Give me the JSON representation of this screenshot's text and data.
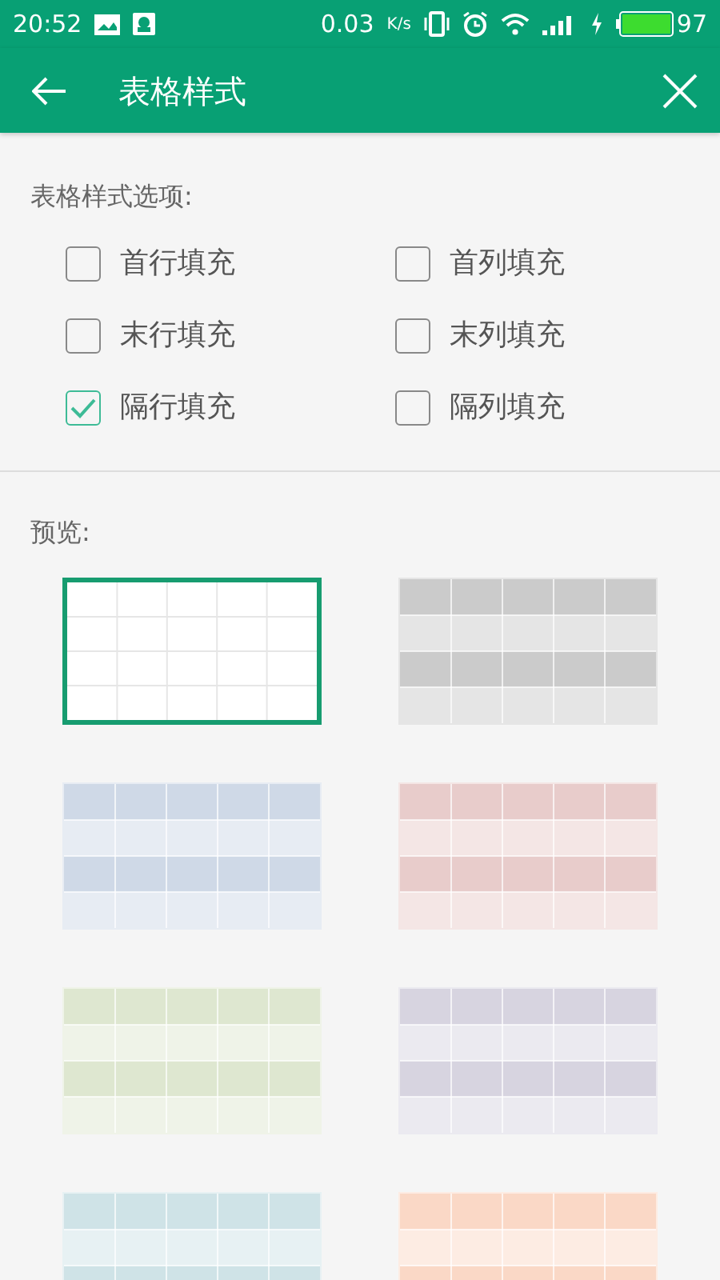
{
  "status_bar": {
    "time": "20:52",
    "speed": "0.03",
    "speed_unit": "K/s",
    "battery": "97"
  },
  "toolbar": {
    "title": "表格样式"
  },
  "options": {
    "label": "表格样式选项:",
    "items": [
      {
        "label": "首行填充",
        "checked": false
      },
      {
        "label": "首列填充",
        "checked": false
      },
      {
        "label": "末行填充",
        "checked": false
      },
      {
        "label": "末列填充",
        "checked": false
      },
      {
        "label": "隔行填充",
        "checked": true
      },
      {
        "label": "隔列填充",
        "checked": false
      }
    ]
  },
  "preview": {
    "label": "预览:",
    "styles": [
      {
        "color": "#ffffff",
        "selected": true
      },
      {
        "color": "#cbcbcb",
        "selected": false
      },
      {
        "color": "#cfd9e7",
        "selected": false
      },
      {
        "color": "#e8cccb",
        "selected": false
      },
      {
        "color": "#dee7d0",
        "selected": false
      },
      {
        "color": "#d7d4e0",
        "selected": false
      },
      {
        "color": "#cfe3e7",
        "selected": false
      },
      {
        "color": "#fad8c6",
        "selected": false
      }
    ]
  }
}
